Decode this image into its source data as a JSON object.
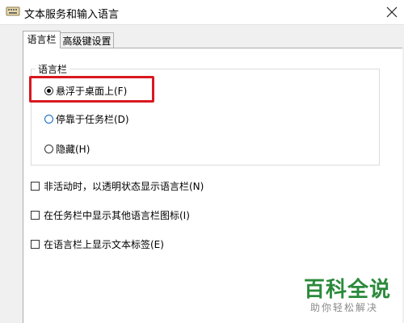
{
  "window": {
    "title": "文本服务和输入语言"
  },
  "tabs": [
    {
      "label": "语言栏",
      "active": true
    },
    {
      "label": "高级键设置",
      "active": false
    }
  ],
  "language_bar_group": {
    "label": "语言栏",
    "options": [
      {
        "label": "悬浮于桌面上(F)",
        "selected": true
      },
      {
        "label": "停靠于任务栏(D)",
        "selected": false
      },
      {
        "label": "隐藏(H)",
        "selected": false
      }
    ]
  },
  "checkboxes": [
    {
      "label": "非活动时，以透明状态显示语言栏(N)",
      "checked": false
    },
    {
      "label": "在任务栏中显示其他语言栏图标(I)",
      "checked": false
    },
    {
      "label": "在语言栏上显示文本标签(E)",
      "checked": false
    }
  ],
  "watermark": {
    "main": "百科全说",
    "sub": "助你轻松解决"
  },
  "colors": {
    "highlight": "#d9181f",
    "watermark": "#2a8a3a"
  }
}
